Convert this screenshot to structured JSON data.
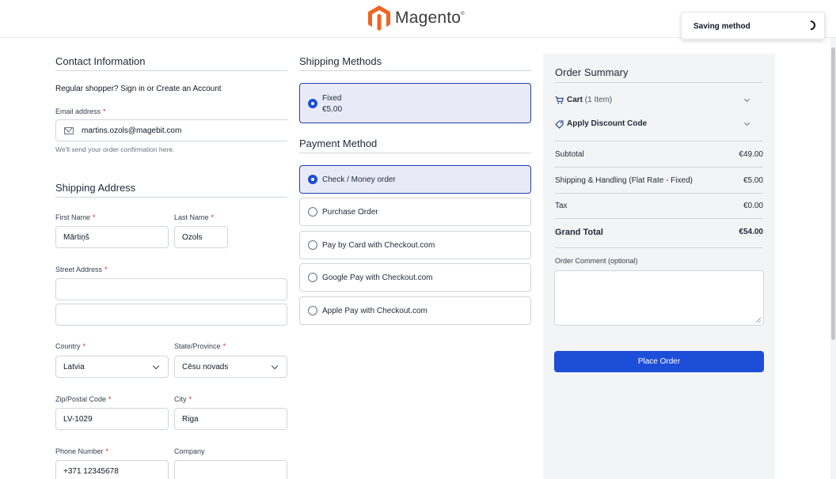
{
  "header": {
    "brand": "Magento",
    "brand_mark": "®"
  },
  "toast": {
    "text": "Saving method"
  },
  "contact": {
    "title": "Contact Information",
    "signin_text": "Regular shopper? Sign in or Create an Account",
    "email_label": "Email address",
    "email_value": "martins.ozols@magebit.com",
    "email_hint": "We'll send your order confirmation here."
  },
  "shipping_address": {
    "title": "Shipping Address",
    "first_name_label": "First Name",
    "first_name_value": "Mārtiņš",
    "last_name_label": "Last Name",
    "last_name_value": "Ozols",
    "street_label": "Street Address",
    "street_line1": "",
    "street_line2": "",
    "country_label": "Country",
    "country_value": "Latvia",
    "state_label": "State/Province",
    "state_value": "Cēsu novads",
    "zip_label": "Zip/Postal Code",
    "zip_value": "LV-1029",
    "city_label": "City",
    "city_value": "Riga",
    "phone_label": "Phone Number",
    "phone_value": "+371 12345678",
    "company_label": "Company",
    "company_value": ""
  },
  "shipping_methods": {
    "title": "Shipping Methods",
    "options": [
      {
        "label": "Fixed",
        "price": "€5.00",
        "selected": true
      }
    ]
  },
  "payment": {
    "title": "Payment Method",
    "options": [
      {
        "label": "Check / Money order",
        "selected": true
      },
      {
        "label": "Purchase Order",
        "selected": false
      },
      {
        "label": "Pay by Card with Checkout.com",
        "selected": false
      },
      {
        "label": "Google Pay with Checkout.com",
        "selected": false
      },
      {
        "label": "Apple Pay with Checkout.com",
        "selected": false
      }
    ]
  },
  "summary": {
    "title": "Order Summary",
    "cart_label": "Cart",
    "cart_count": "(1 Item)",
    "discount_label": "Apply Discount Code",
    "subtotal_label": "Subtotal",
    "subtotal_value": "€49.00",
    "shipping_label": "Shipping & Handling (Flat Rate - Fixed)",
    "shipping_value": "€5.00",
    "tax_label": "Tax",
    "tax_value": "€0.00",
    "grand_total_label": "Grand Total",
    "grand_total_value": "€54.00",
    "comment_label": "Order Comment (optional)",
    "place_order_label": "Place Order"
  },
  "colors": {
    "accent": "#1d4ed8",
    "brand_orange": "#f26322",
    "required": "#dc2626"
  }
}
